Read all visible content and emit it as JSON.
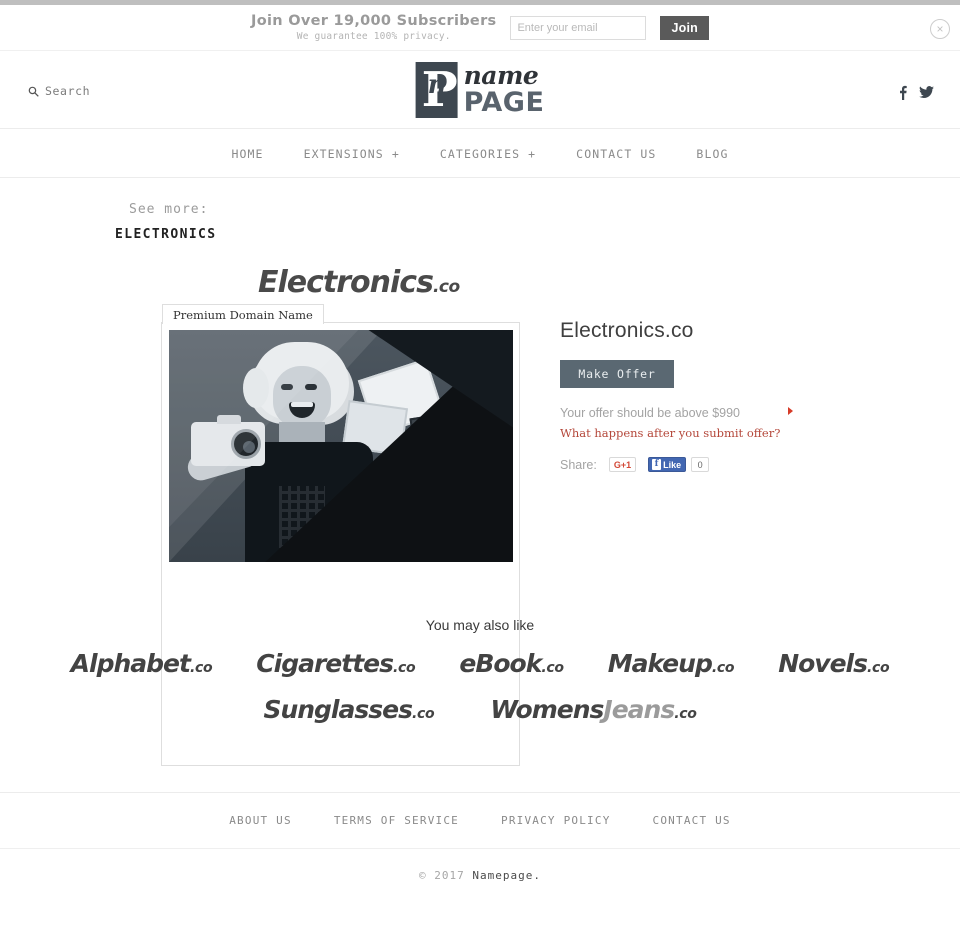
{
  "subscribe": {
    "headline": "Join Over 19,000 Subscribers",
    "subline": "We guarantee 100% privacy.",
    "email_placeholder": "Enter your email",
    "email_value": "",
    "join_label": "Join",
    "close_icon": "×"
  },
  "header": {
    "search_label": "Search",
    "search_icon": "search-icon",
    "logo": {
      "mark_p": "P",
      "mark_n": "n",
      "name": "name",
      "page": "PAGE"
    },
    "social": [
      {
        "name": "facebook-icon",
        "label": "f"
      },
      {
        "name": "twitter-icon",
        "label": "t"
      }
    ]
  },
  "nav": {
    "items": [
      {
        "label": "HOME"
      },
      {
        "label": "EXTENSIONS +"
      },
      {
        "label": "CATEGORIES +"
      },
      {
        "label": "CONTACT US"
      },
      {
        "label": "BLOG"
      }
    ]
  },
  "breadcrumb": {
    "see_more_label": "See more:",
    "category": "ELECTRONICS"
  },
  "product": {
    "wordmark_name": "Electronics",
    "wordmark_tld": ".co",
    "card_tab": "Premium Domain Name",
    "photo_alt": "Woman holding camera with shopping bags and boxes",
    "title": "Electronics.co",
    "make_offer_label": "Make Offer",
    "offer_note": "Your offer should be above $990",
    "offer_min_price": "$990",
    "offer_link": "What happens after you submit offer?",
    "share_label": "Share:",
    "gplus_label": "G+1",
    "fb_like_label": "Like",
    "fb_count": "0"
  },
  "also_like": {
    "title": "You may also like",
    "row1": [
      {
        "name": "Alphabet",
        "tld": ".co"
      },
      {
        "name": "Cigarettes",
        "tld": ".co"
      },
      {
        "name": "eBook",
        "tld": ".co"
      },
      {
        "name": "Makeup",
        "tld": ".co"
      },
      {
        "name": "Novels",
        "tld": ".co"
      }
    ],
    "row2": [
      {
        "name": "Sunglasses",
        "tld": ".co",
        "name2": ""
      },
      {
        "name": "Womens",
        "name2": "Jeans",
        "tld": ".co"
      }
    ]
  },
  "footer": {
    "links": [
      {
        "label": "ABOUT US"
      },
      {
        "label": "TERMS OF SERVICE"
      },
      {
        "label": "PRIVACY POLICY"
      },
      {
        "label": "CONTACT US"
      }
    ],
    "copyright_prefix": "© 2017 ",
    "copyright_brand": "Namepage."
  },
  "colors": {
    "accent_button": "#5a6872",
    "logo_dark": "#3e4750",
    "link_red": "#b4473a",
    "facebook_blue": "#4267b2",
    "gplus_red": "#d34836"
  }
}
